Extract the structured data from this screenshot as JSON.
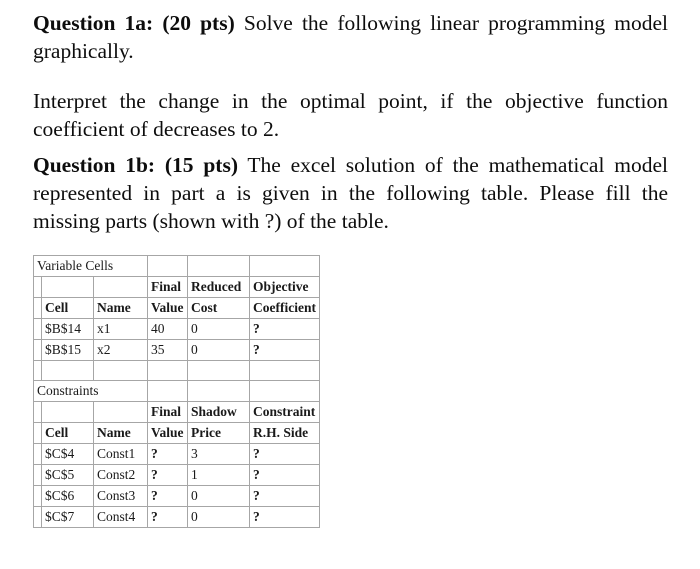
{
  "document": {
    "questions": [
      {
        "id": "q1a",
        "label": "Question 1a: (20 pts)",
        "body": "Solve the following linear programming model graphically."
      },
      {
        "id": "q1a-interpret",
        "label": "",
        "body": "Interpret the change in the optimal point, if the objective function coefficient of decreases to 2."
      },
      {
        "id": "q1b",
        "label": "Question 1b: (15 pts)",
        "body": "The excel solution of the mathematical model represented in part a is given in the following table. Please fill the missing parts (shown with ?) of the table."
      }
    ]
  },
  "table": {
    "header_color": "#1f1f5c",
    "border_color": "#a6a6a6",
    "sections": [
      {
        "title": "Variable Cells",
        "header_top": [
          "",
          "",
          "Final",
          "Reduced",
          "Objective"
        ],
        "header_bottom": [
          "Cell",
          "Name",
          "Value",
          "Cost",
          "Coefficient"
        ],
        "rows": [
          [
            "$B$14",
            "x1",
            "40",
            "0",
            "?"
          ],
          [
            "$B$15",
            "x2",
            "35",
            "0",
            "?"
          ]
        ]
      },
      {
        "title": "Constraints",
        "header_top": [
          "",
          "",
          "Final",
          "Shadow",
          "Constraint"
        ],
        "header_bottom": [
          "Cell",
          "Name",
          "Value",
          "Price",
          "R.H. Side"
        ],
        "rows": [
          [
            "$C$4",
            "Const1",
            "?",
            "3",
            "?"
          ],
          [
            "$C$5",
            "Const2",
            "?",
            "1",
            "?"
          ],
          [
            "$C$6",
            "Const3",
            "?",
            "0",
            "?"
          ],
          [
            "$C$7",
            "Const4",
            "?",
            "0",
            "?"
          ]
        ]
      }
    ]
  }
}
